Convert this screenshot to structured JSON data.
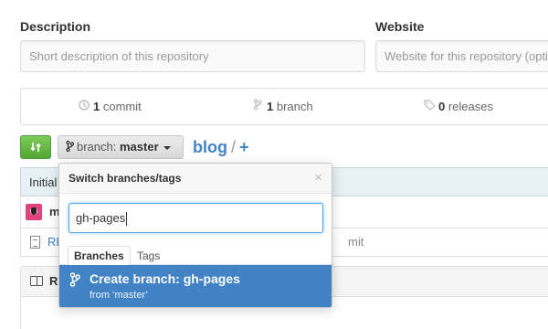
{
  "fields": {
    "description": {
      "label": "Description",
      "placeholder": "Short description of this repository"
    },
    "website": {
      "label": "Website",
      "placeholder": "Website for this repository (opti"
    }
  },
  "numbers": {
    "commits": {
      "count": "1",
      "label": " commit",
      "icon": "history-icon"
    },
    "branches": {
      "count": "1",
      "label": " branch",
      "icon": "branch-icon"
    },
    "releases": {
      "count": "0",
      "label": " releases",
      "icon": "tag-icon"
    }
  },
  "toolbar": {
    "compare_icon": "compare-icon",
    "branch_prefix": "branch: ",
    "branch_name": "master",
    "repo_name": "blog",
    "separator": "/",
    "add_file": "+"
  },
  "commit": {
    "message": "Initial"
  },
  "committer": {
    "name": "m"
  },
  "file": {
    "name": "RE",
    "message": "mit"
  },
  "readme": {
    "title": "R"
  },
  "dropdown": {
    "title": "Switch branches/tags",
    "close": "×",
    "filter_value": "gh-pages",
    "tabs": [
      "Branches",
      "Tags"
    ],
    "create_title": "Create branch: gh-pages",
    "create_sub": "from ‘master’"
  },
  "colors": {
    "accent_blue": "#4183c4",
    "green_button": "#55a532",
    "focus_blue": "#51a7e8",
    "commit_bar": "#e6f1f6"
  }
}
